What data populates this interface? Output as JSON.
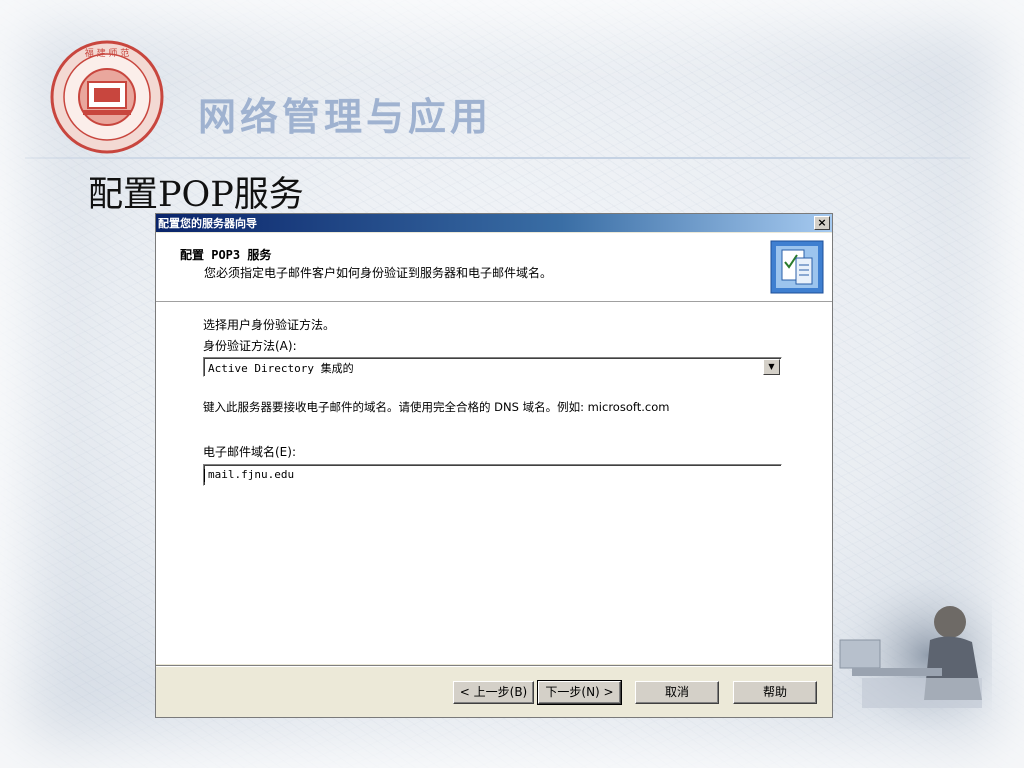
{
  "slide": {
    "course_title": "网络管理与应用",
    "heading": "配置POP服务"
  },
  "dialog": {
    "window_title": "配置您的服务器向导",
    "close_glyph": "×",
    "header": {
      "title": "配置 POP3 服务",
      "subtitle": "您必须指定电子邮件客户如何身份验证到服务器和电子邮件域名。"
    },
    "auth": {
      "instruction": "选择用户身份验证方法。",
      "method_label": "身份验证方法(A):",
      "method_value": "Active Directory 集成的"
    },
    "domain": {
      "instruction": "键入此服务器要接收电子邮件的域名。请使用完全合格的 DNS 域名。例如: microsoft.com",
      "label": "电子邮件域名(E):",
      "value": "mail.fjnu.edu"
    },
    "buttons": {
      "back": "< 上一步(B)",
      "next": "下一步(N) >",
      "cancel": "取消",
      "help": "帮助"
    }
  },
  "colors": {
    "titlebar_start": "#0a246a",
    "titlebar_end": "#a6caf0",
    "course_title": "#9fb2d0",
    "logo_red": "#c8463e"
  },
  "icons": [
    "university-seal-logo",
    "wizard-document-icon",
    "dropdown-arrow-icon",
    "close-icon"
  ]
}
